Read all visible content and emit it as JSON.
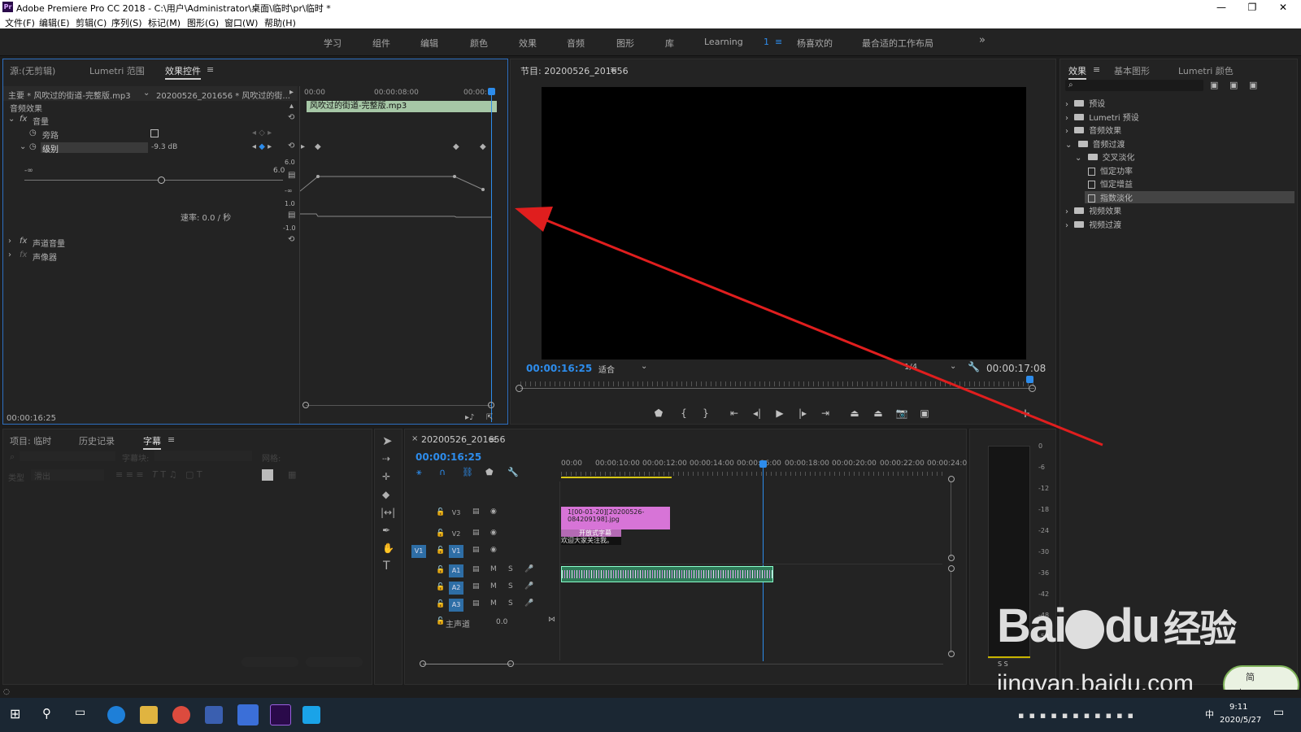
{
  "window": {
    "title": "Adobe Premiere Pro CC 2018 - C:\\用户\\Administrator\\桌面\\临时\\pr\\临时 *",
    "logo": "Pr",
    "min": "—",
    "max": "❐",
    "close": "✕"
  },
  "menu": [
    "文件(F)",
    "编辑(E)",
    "剪辑(C)",
    "序列(S)",
    "标记(M)",
    "图形(G)",
    "窗口(W)",
    "帮助(H)"
  ],
  "workspaces": [
    "学习",
    "组件",
    "编辑",
    "颜色",
    "效果",
    "音频",
    "图形",
    "库",
    "Learning",
    "1",
    "杨喜欢的",
    "最合适的工作布局",
    "»"
  ],
  "effect_controls": {
    "tabs": [
      "源:(无剪辑)",
      "Lumetri 范围",
      "效果控件"
    ],
    "master": "主要 * 风吹过的街道-完整版.mp3",
    "sequence_clip": "20200526_201656 * 风吹过的街...",
    "ruler": [
      "00:00",
      "00:00:08:00",
      "00:00:1"
    ],
    "clip_name": "风吹过的街道-完整版.mp3",
    "section": "音频效果",
    "volume": "音量",
    "bypass": "旁路",
    "level": "级别",
    "level_value": "-9.3 dB",
    "slider_min": "-∞",
    "slider_max": "6.0",
    "graph_ticks": [
      "6.0",
      "-∞",
      "1.0",
      "-1.0"
    ],
    "velocity": "速率: 0.0 / 秒",
    "channel_volume": "声道音量",
    "panner": "声像器",
    "timecode": "00:00:16:25"
  },
  "program": {
    "title": "节目: 20200526_201656",
    "timecode": "00:00:16:25",
    "fit": "适合",
    "quality": "1/4",
    "duration": "00:00:17:08"
  },
  "effects_panel": {
    "tabs": [
      "效果",
      "基本图形",
      "Lumetri 颜色"
    ],
    "tree": [
      {
        "label": "预设",
        "level": 0,
        "type": "folder"
      },
      {
        "label": "Lumetri 预设",
        "level": 0,
        "type": "folder"
      },
      {
        "label": "音频效果",
        "level": 0,
        "type": "folder"
      },
      {
        "label": "音频过渡",
        "level": 0,
        "type": "folder",
        "open": true
      },
      {
        "label": "交叉淡化",
        "level": 1,
        "type": "folder",
        "open": true
      },
      {
        "label": "恒定功率",
        "level": 2,
        "type": "file"
      },
      {
        "label": "恒定增益",
        "level": 2,
        "type": "file"
      },
      {
        "label": "指数淡化",
        "level": 2,
        "type": "file",
        "selected": true
      },
      {
        "label": "视频效果",
        "level": 0,
        "type": "folder"
      },
      {
        "label": "视频过渡",
        "level": 0,
        "type": "folder"
      }
    ]
  },
  "project_panel": {
    "tabs": [
      "项目: 临时",
      "历史记录",
      "字幕"
    ],
    "row1": [
      "字幕块:",
      "网格:"
    ],
    "row2": [
      "类型",
      "滑出"
    ]
  },
  "timeline": {
    "sequence": "20200526_201656",
    "timecode": "00:00:16:25",
    "ruler": [
      "00:00",
      "00:00:10:00",
      "00:00:12:00",
      "00:00:14:00",
      "00:00:16:00",
      "00:00:18:00",
      "00:00:20:00",
      "00:00:22:00",
      "00:00:24:0"
    ],
    "tracks": [
      "V3",
      "V2",
      "V1",
      "A1",
      "A2",
      "A3"
    ],
    "source_patch": "V1",
    "master_track": "主声道",
    "master_value": "0.0",
    "clip_image": "1[00-01-20][20200526-084209198].jpg",
    "clip_title": "开放式字幕",
    "clip_caption": "欢迎大家关注我。"
  },
  "meter": {
    "scale": [
      "0",
      "-6",
      "-12",
      "-18",
      "-24",
      "-30",
      "-36",
      "-42",
      "-48",
      "-54"
    ],
    "solo": "S  S"
  },
  "watermark": {
    "brand": "Bai",
    "brand_suffix": "du",
    "brand_cn": "经验",
    "url": "jingyan.baidu.com"
  },
  "ime": {
    "line1": "简",
    "line2": "中"
  },
  "taskbar": {
    "time": "9:11",
    "date": "2020/5/27"
  },
  "colors": {
    "accent": "#2d8ceb",
    "arrow": "#e01e1e",
    "clip_pink": "#d774d7",
    "audio_green": "#2f7a58"
  }
}
